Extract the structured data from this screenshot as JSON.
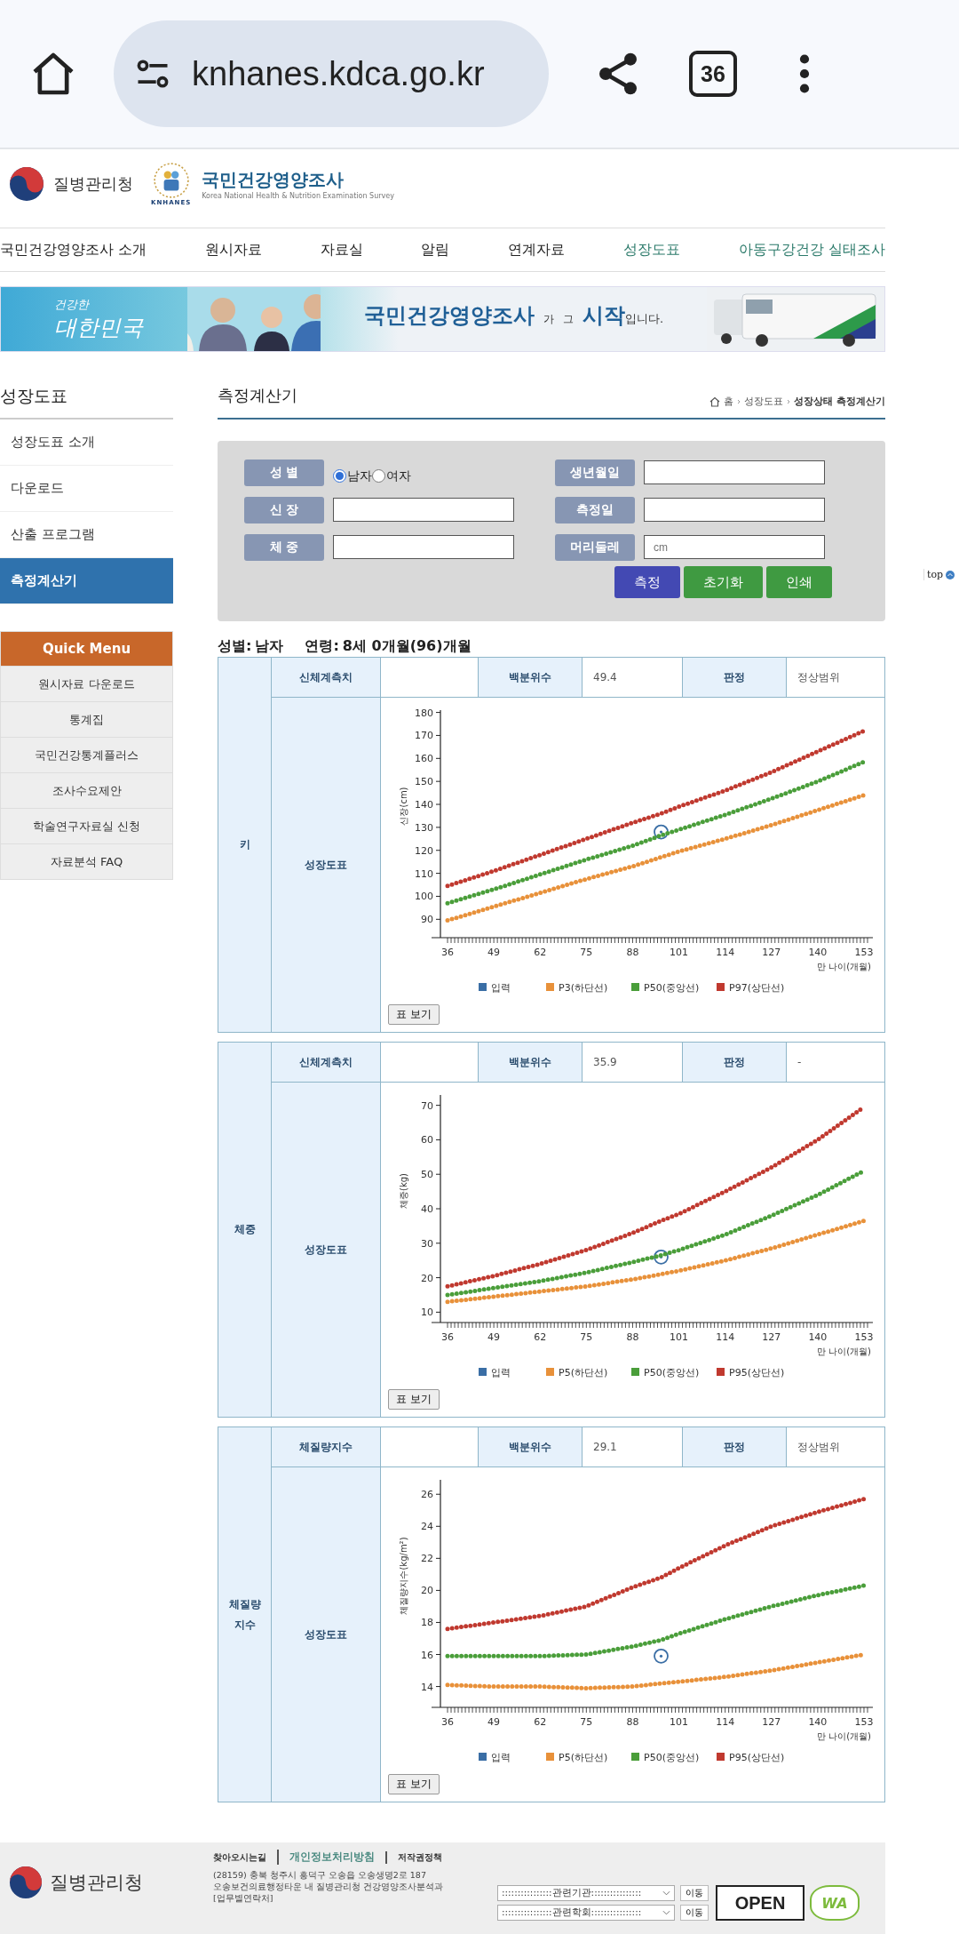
{
  "browser": {
    "url": "knhanes.kdca.go.kr",
    "tab_count": "36"
  },
  "header": {
    "agency": "질병관리청",
    "logo_text": "KNHANES",
    "site_title": "국민건강영양조사",
    "site_subtitle": "Korea National Health & Nutrition Examination Survey"
  },
  "nav": [
    {
      "label": "국민건강영양조사 소개",
      "highlighted": false
    },
    {
      "label": "원시자료",
      "highlighted": false
    },
    {
      "label": "자료실",
      "highlighted": false
    },
    {
      "label": "알림",
      "highlighted": false
    },
    {
      "label": "연계자료",
      "highlighted": false
    },
    {
      "label": "성장도표",
      "highlighted": true
    },
    {
      "label": "아동구강건강 실태조사",
      "highlighted": true
    }
  ],
  "banner": {
    "slogan_top": "건강한",
    "slogan_main": "대한민국",
    "headline": "국민건강영양조사",
    "particle": "가",
    "word": "그",
    "highlight": "시작",
    "ending": "입니다."
  },
  "sidebar": {
    "title": "성장도표",
    "items": [
      {
        "label": "성장도표 소개",
        "selected": false
      },
      {
        "label": "다운로드",
        "selected": false
      },
      {
        "label": "산출 프로그램",
        "selected": false
      },
      {
        "label": "측정계산기",
        "selected": true
      }
    ]
  },
  "quick_menu": {
    "title": "Quick Menu",
    "items": [
      "원시자료 다운로드",
      "통계집",
      "국민건강통계플러스",
      "조사수요제안",
      "학술연구자료실 신청",
      "자료분석 FAQ"
    ]
  },
  "page": {
    "title": "측정계산기",
    "breadcrumb": [
      "홈",
      "성장도표",
      "성장상태 측정계산기"
    ]
  },
  "form": {
    "fields": [
      {
        "label": "성 별",
        "kind": "radio",
        "options": [
          {
            "label": "남자",
            "selected": true
          },
          {
            "label": "여자",
            "selected": false
          }
        ]
      },
      {
        "label": "신 장",
        "kind": "text"
      },
      {
        "label": "체 중",
        "kind": "text"
      },
      {
        "label": "생년월일",
        "kind": "text"
      },
      {
        "label": "측정일",
        "kind": "text"
      },
      {
        "label": "머리둘레",
        "kind": "text",
        "placeholder": "cm"
      }
    ],
    "buttons": [
      {
        "label": "측정",
        "color": "#4349b3"
      },
      {
        "label": "초기화",
        "color": "#3f9a41"
      },
      {
        "label": "인쇄",
        "color": "#3f9a41"
      }
    ]
  },
  "summary": {
    "sex_label": "성별:",
    "sex": "남자",
    "age_label": "연령:",
    "age": "8세 0개월(96)개월"
  },
  "results": [
    {
      "section": "키",
      "measure_label": "신체계측치",
      "percentile_label": "백분위수",
      "percentile": "49.4",
      "verdict_label": "판정",
      "verdict": "정상범위",
      "chart_label": "성장도표",
      "table_button": "표 보기",
      "chart_data": {
        "type": "line",
        "legend": "bottom",
        "xlabel": "만 나이(개월)",
        "ylabel": "신장(cm)",
        "x": [
          36,
          49,
          62,
          75,
          88,
          96,
          101,
          114,
          127,
          140,
          153
        ],
        "xlim": [
          34,
          155
        ],
        "ylim": [
          82,
          181
        ],
        "xticks": [
          36,
          49,
          62,
          75,
          88,
          101,
          114,
          127,
          140,
          153
        ],
        "yticks": [
          90,
          100,
          110,
          120,
          130,
          140,
          150,
          160,
          170,
          180
        ],
        "series": [
          {
            "name": "입력",
            "color": "#3a6ea5",
            "marker": "circle",
            "values": [
              null,
              null,
              null,
              null,
              null,
              128,
              null,
              null,
              null,
              null,
              null
            ]
          },
          {
            "name": "P3(하단선)",
            "color": "#e8913a",
            "line_style": "dotted",
            "values": [
              89.5,
              95.5,
              101.5,
              107.5,
              113,
              117,
              119.5,
              125,
              131,
              137.5,
              144
            ]
          },
          {
            "name": "P50(중앙선)",
            "color": "#4a9e3a",
            "line_style": "dotted",
            "values": [
              97,
              103,
              109.5,
              116,
              122,
              126.5,
              129,
              135.5,
              142.5,
              150,
              158.5
            ]
          },
          {
            "name": "P97(상단선)",
            "color": "#c0392f",
            "line_style": "dotted",
            "values": [
              104.5,
              111,
              118,
              125,
              132,
              136,
              139,
              146,
              154,
              163,
              172
            ]
          }
        ]
      }
    },
    {
      "section": "체중",
      "measure_label": "신체계측치",
      "percentile_label": "백분위수",
      "percentile": "35.9",
      "verdict_label": "판정",
      "verdict": "-",
      "chart_label": "성장도표",
      "table_button": "표 보기",
      "chart_data": {
        "type": "line",
        "legend": "bottom",
        "xlabel": "만 나이(개월)",
        "ylabel": "체중(kg)",
        "x": [
          36,
          49,
          62,
          75,
          88,
          96,
          101,
          114,
          127,
          140,
          153
        ],
        "xlim": [
          34,
          155
        ],
        "ylim": [
          7,
          73
        ],
        "xticks": [
          36,
          49,
          62,
          75,
          88,
          101,
          114,
          127,
          140,
          153
        ],
        "yticks": [
          10,
          20,
          30,
          40,
          50,
          60,
          70
        ],
        "series": [
          {
            "name": "입력",
            "color": "#3a6ea5",
            "marker": "circle",
            "values": [
              null,
              null,
              null,
              null,
              null,
              26,
              null,
              null,
              null,
              null,
              null
            ]
          },
          {
            "name": "P5(하단선)",
            "color": "#e8913a",
            "line_style": "dotted",
            "values": [
              13,
              14.5,
              16,
              17.5,
              19.5,
              21,
              22,
              25,
              28.5,
              32.5,
              36.5
            ]
          },
          {
            "name": "P50(중앙선)",
            "color": "#4a9e3a",
            "line_style": "dotted",
            "values": [
              15,
              17,
              19,
              21.5,
              24.5,
              26.5,
              28,
              32.5,
              38,
              44,
              51
            ]
          },
          {
            "name": "P95(상단선)",
            "color": "#c0392f",
            "line_style": "dotted",
            "values": [
              17.5,
              20.5,
              24,
              28,
              33,
              36.5,
              38.5,
              45,
              52,
              60,
              69.5
            ]
          }
        ]
      }
    },
    {
      "section": "체질량\n지수",
      "measure_label": "체질량지수",
      "percentile_label": "백분위수",
      "percentile": "29.1",
      "verdict_label": "판정",
      "verdict": "정상범위",
      "chart_label": "성장도표",
      "table_button": "표 보기",
      "chart_data": {
        "type": "line",
        "legend": "bottom",
        "xlabel": "만 나이(개월)",
        "ylabel": "체질량지수(kg/m²)",
        "x": [
          36,
          49,
          62,
          75,
          88,
          96,
          101,
          114,
          127,
          140,
          153
        ],
        "xlim": [
          34,
          155
        ],
        "ylim": [
          12.7,
          26.9
        ],
        "xticks": [
          36,
          49,
          62,
          75,
          88,
          101,
          114,
          127,
          140,
          153
        ],
        "yticks": [
          14,
          16,
          18,
          20,
          22,
          24,
          26
        ],
        "series": [
          {
            "name": "입력",
            "color": "#3a6ea5",
            "marker": "circle",
            "values": [
              null,
              null,
              null,
              null,
              null,
              15.9,
              null,
              null,
              null,
              null,
              null
            ]
          },
          {
            "name": "P5(하단선)",
            "color": "#e8913a",
            "line_style": "dotted",
            "values": [
              14.1,
              14,
              14,
              13.9,
              14,
              14.2,
              14.3,
              14.6,
              15,
              15.5,
              16
            ]
          },
          {
            "name": "P50(중앙선)",
            "color": "#4a9e3a",
            "line_style": "dotted",
            "values": [
              15.9,
              15.9,
              15.9,
              16,
              16.5,
              16.9,
              17.3,
              18.2,
              19,
              19.7,
              20.3
            ]
          },
          {
            "name": "P95(상단선)",
            "color": "#c0392f",
            "line_style": "dotted",
            "values": [
              17.6,
              18,
              18.4,
              19,
              20.2,
              20.8,
              21.4,
              22.8,
              24,
              24.9,
              25.7
            ]
          }
        ]
      }
    }
  ],
  "footer": {
    "agency": "질병관리청",
    "links": [
      {
        "label": "찾아오시는길",
        "highlighted": false
      },
      {
        "label": "개인정보처리방침",
        "highlighted": true
      },
      {
        "label": "저작권정책",
        "highlighted": false
      }
    ],
    "address": [
      "(28159) 충북 청주시 흥덕구 오송읍 오송생명2로 187",
      "오송보건의료행정타운 내 질병관리청 건강영양조사분석과",
      "[업무별연락처]"
    ],
    "selects": [
      {
        "value": "::::::::::::::::관련기관::::::::::::::::",
        "button": "이동"
      },
      {
        "value": "::::::::::::::::관련학회::::::::::::::::",
        "button": "이동"
      }
    ],
    "open_badge": "OPEN",
    "wa_badge": "WA"
  },
  "top_button": "top"
}
